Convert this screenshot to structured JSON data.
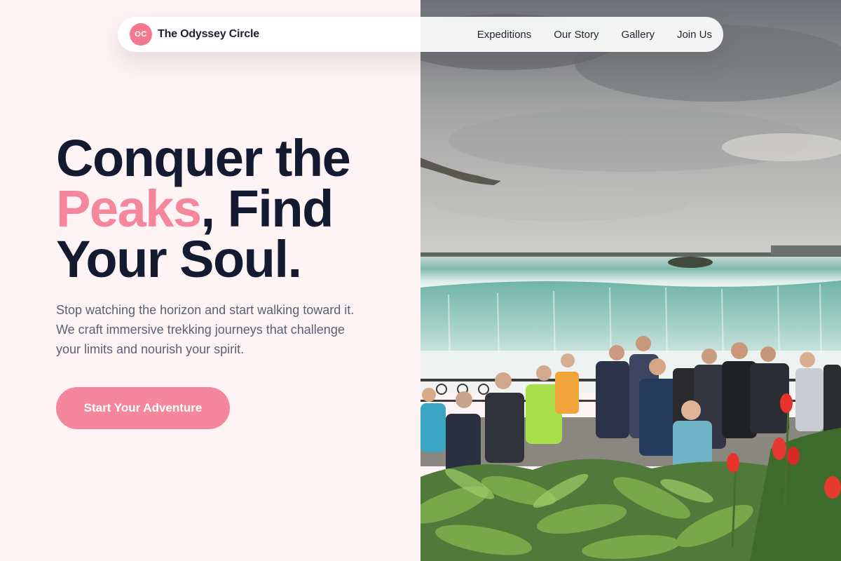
{
  "nav": {
    "logo_initials": "OC",
    "brand": "The Odyssey Circle",
    "links": [
      "Expeditions",
      "Our Story",
      "Gallery",
      "Join Us"
    ]
  },
  "hero": {
    "headline_line1": "Conquer the",
    "headline_accent": "Peaks",
    "headline_line2_rest": ", Find",
    "headline_line3": "Your Soul.",
    "subtitle": "Stop watching the horizon and start walking toward it. We craft immersive trekking journeys that challenge your limits and nourish your spirit.",
    "cta_label": "Start Your Adventure"
  },
  "photo": {
    "description_icon": "waterfall-photo"
  },
  "colors": {
    "accent": "#f4879c",
    "logo_badge": "#f4788f",
    "heading": "#141a30",
    "body_text": "#5b6173",
    "background": "#fff4f5"
  }
}
